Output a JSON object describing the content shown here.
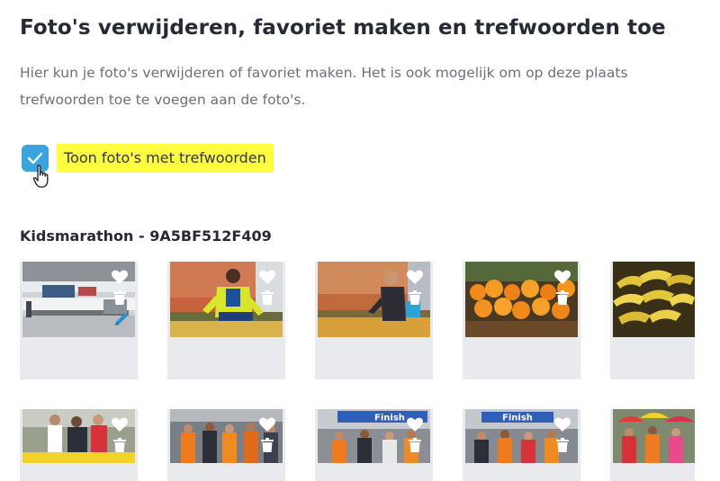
{
  "header": {
    "title": "Foto's verwijderen, favoriet maken en trefwoorden toe",
    "intro": "Hier kun je foto's verwijderen of favoriet maken. Het is ook mogelijk om op deze plaats trefwoorden toe te voegen aan de foto's."
  },
  "filter": {
    "checkbox_checked": true,
    "label": "Toon foto's met trefwoorden",
    "highlight_color": "#fffb3f",
    "accent_color": "#3aa4de"
  },
  "album": {
    "title": "Kidsmarathon - 9A5BF512F409",
    "photos_row1": [
      {
        "id": "p1",
        "subject": "expo-hall",
        "actions": [
          "favorite",
          "delete",
          "edit"
        ]
      },
      {
        "id": "p2",
        "subject": "worker-yellow-jacket",
        "actions": [
          "favorite",
          "delete"
        ]
      },
      {
        "id": "p3",
        "subject": "man-at-stand",
        "actions": [
          "favorite",
          "delete"
        ]
      },
      {
        "id": "p4",
        "subject": "oranges",
        "actions": [
          "favorite",
          "delete"
        ]
      },
      {
        "id": "p5",
        "subject": "bananas",
        "actions": [
          "favorite",
          "delete"
        ]
      }
    ],
    "photos_row2": [
      {
        "id": "p6",
        "subject": "runners",
        "banner": ""
      },
      {
        "id": "p7",
        "subject": "runners-orange",
        "banner": ""
      },
      {
        "id": "p8",
        "subject": "finish-arch",
        "banner": "Finish"
      },
      {
        "id": "p9",
        "subject": "finish-arch",
        "banner": "Finish"
      },
      {
        "id": "p10",
        "subject": "crowd-umbrellas",
        "banner": ""
      }
    ]
  },
  "icons": {
    "heart": "heart-icon",
    "trash": "trash-icon",
    "pencil": "pencil-icon",
    "check": "checkmark-icon",
    "cursor": "hand-pointer-icon"
  }
}
